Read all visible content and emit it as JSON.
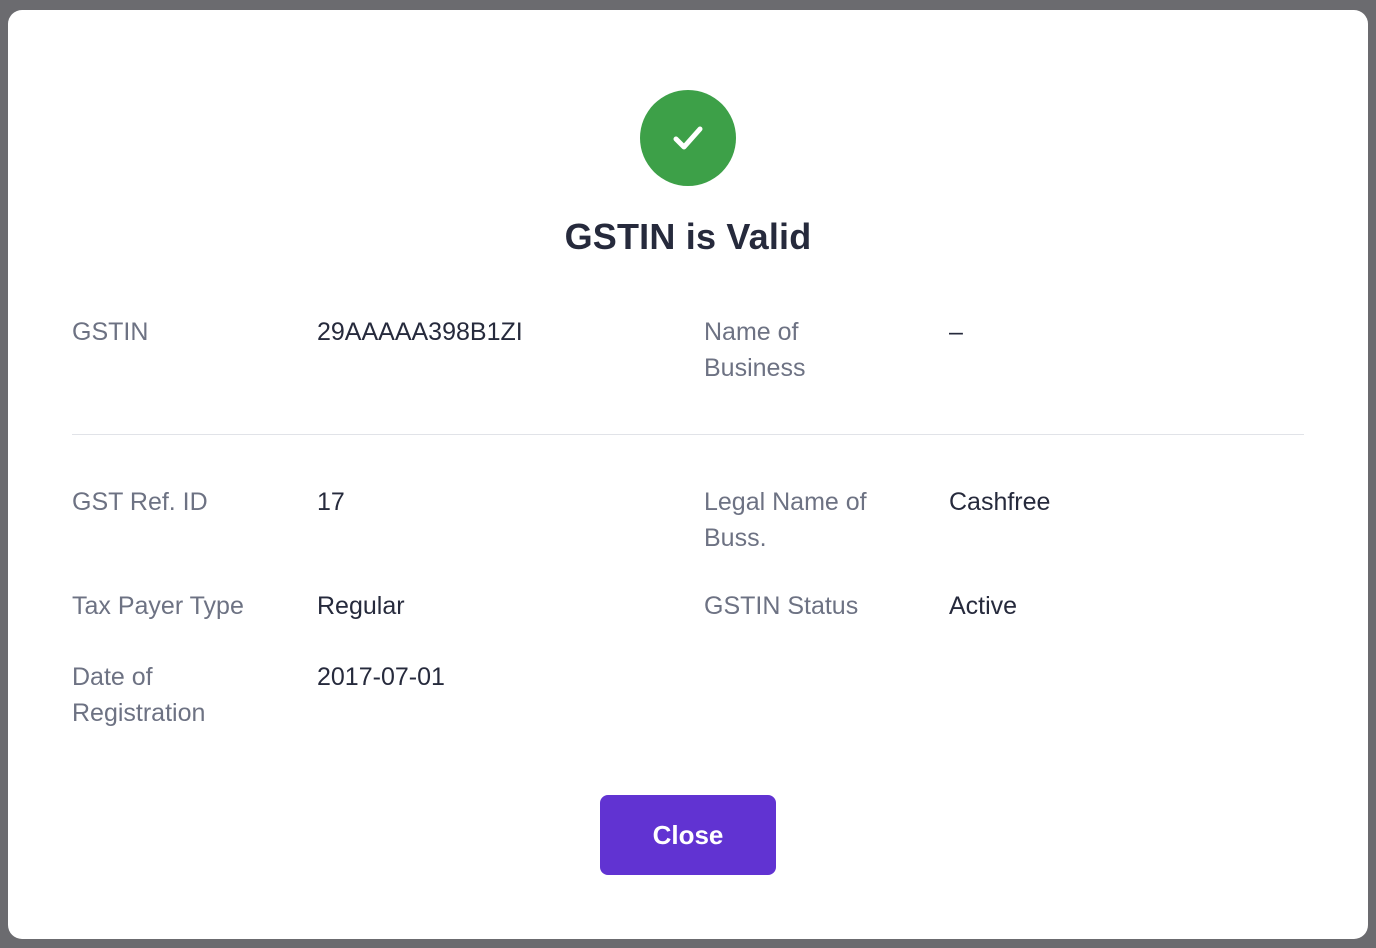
{
  "modal": {
    "title": "GSTIN is Valid",
    "status_icon": "check-icon",
    "status_color": "#3da048",
    "close_label": "Close",
    "accent_color": "#6133d2"
  },
  "fields": {
    "gstin": {
      "label": "GSTIN",
      "value": "29AAAAA398B1ZI"
    },
    "business_name": {
      "label": "Name of Business",
      "value": "–"
    },
    "gst_ref_id": {
      "label": "GST Ref. ID",
      "value": "17"
    },
    "legal_name": {
      "label": "Legal Name of Buss.",
      "value": "Cashfree"
    },
    "tax_payer_type": {
      "label": "Tax Payer Type",
      "value": "Regular"
    },
    "gstin_status": {
      "label": "GSTIN Status",
      "value": "Active"
    },
    "registration_date": {
      "label": "Date of Registration",
      "value": "2017-07-01"
    }
  }
}
